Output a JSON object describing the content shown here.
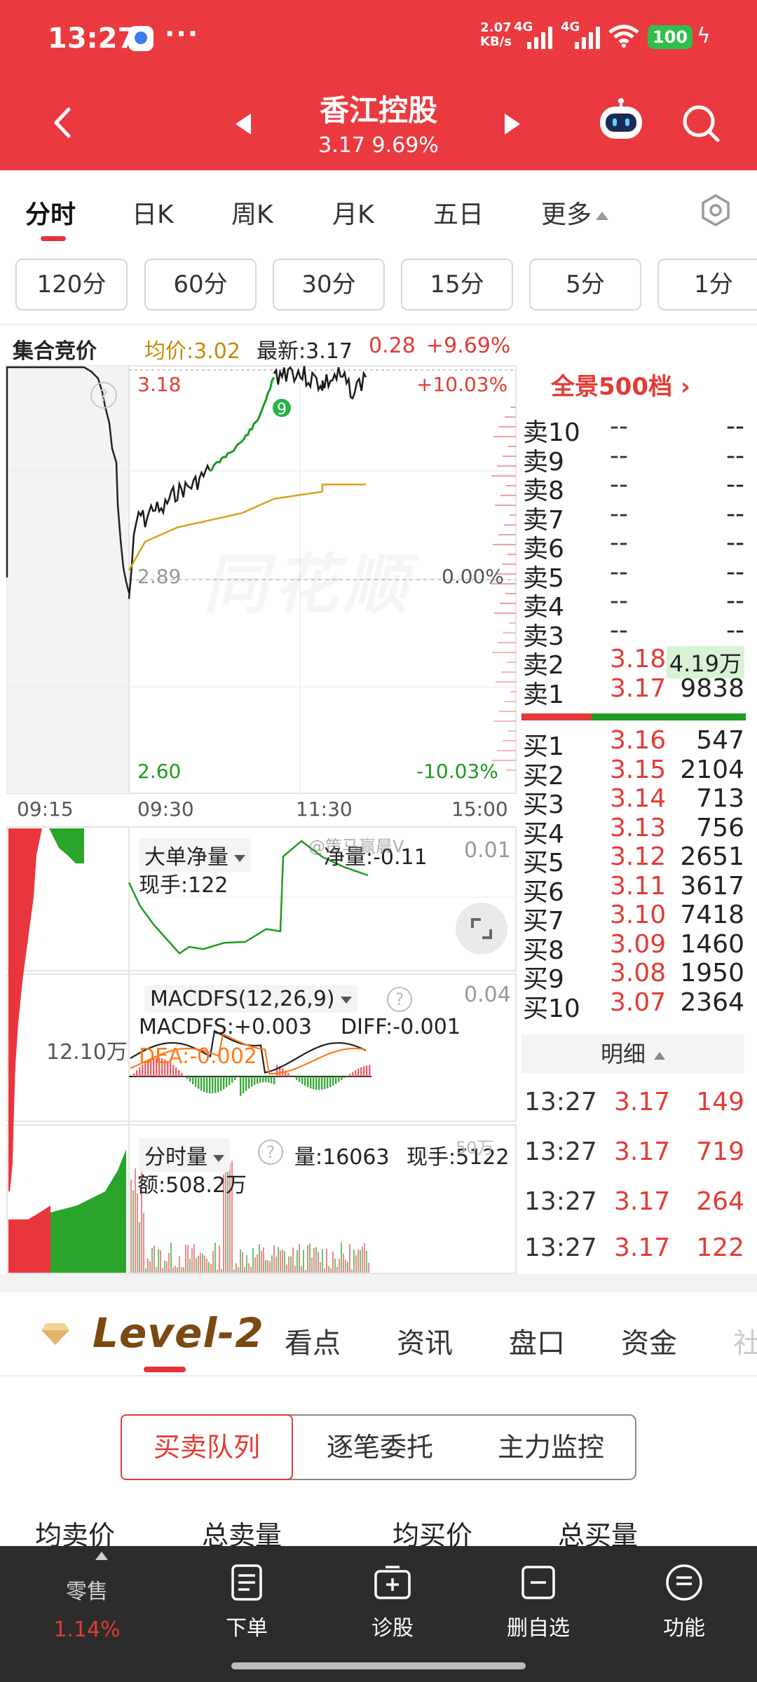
{
  "status": {
    "time": "13:27",
    "dots": "···",
    "speed_value": "2.07",
    "speed_unit": "KB/s",
    "sig1": "4G",
    "sig2": "4G",
    "battery": "100"
  },
  "header": {
    "title": "香江控股",
    "subtitle": "3.17 9.69%"
  },
  "tabs": [
    {
      "label": "分时"
    },
    {
      "label": "日K"
    },
    {
      "label": "周K"
    },
    {
      "label": "月K"
    },
    {
      "label": "五日"
    },
    {
      "label": "更多"
    }
  ],
  "minute_buttons": [
    "120分",
    "60分",
    "30分",
    "15分",
    "5分",
    "1分"
  ],
  "info": {
    "auction": "集合竞价",
    "avg": "均价:3.02",
    "latest": "最新:3.17",
    "change": "0.28",
    "pct": "+9.69%"
  },
  "chart": {
    "price_high": "3.18",
    "price_mid": "2.89",
    "price_low": "2.60",
    "pct_high": "+10.03%",
    "pct_mid": "0.00%",
    "pct_low": "-10.03%",
    "times": [
      "09:15",
      "09:30",
      "11:30",
      "15:00"
    ],
    "auction_volume": "12.10万",
    "marker": "9"
  },
  "chart_data": {
    "type": "line",
    "title": "",
    "x_range": [
      "09:30",
      "15:00"
    ],
    "ylim": [
      2.6,
      3.18
    ],
    "prev_close": 2.89,
    "series": [
      {
        "x": [
          "09:30",
          "09:33",
          "09:36",
          "09:40",
          "09:45",
          "09:50",
          "09:55",
          "10:00",
          "10:10",
          "10:20",
          "10:30",
          "10:40",
          "10:50",
          "11:00",
          "11:10",
          "11:20",
          "11:30",
          "13:00",
          "13:10",
          "13:20",
          "13:27"
        ],
        "values": [
          2.86,
          2.94,
          2.98,
          2.97,
          2.99,
          2.98,
          3.0,
          3.01,
          3.02,
          3.04,
          3.06,
          3.08,
          3.11,
          3.17,
          3.18,
          3.17,
          3.16,
          3.16,
          3.17,
          3.15,
          3.17
        ]
      },
      {
        "x": [
          "09:30",
          "09:40",
          "10:00",
          "10:20",
          "10:40",
          "11:00",
          "11:30",
          "13:00",
          "13:27"
        ],
        "values": [
          2.9,
          2.94,
          2.96,
          2.97,
          2.98,
          3.0,
          3.01,
          3.02,
          3.02
        ]
      }
    ]
  },
  "sub1": {
    "name": "大单净量",
    "hand": "现手:122",
    "net": "净量:-0.11",
    "scale": "0.01"
  },
  "sub2": {
    "name": "MACDFS(12,26,9)",
    "macd": "MACDFS:+0.003",
    "diff": "DIFF:-0.001",
    "dea": "DEA:-0.002",
    "scale": "0.04"
  },
  "sub3": {
    "name": "分时量",
    "vol": "量:16063",
    "hand": "现手:5122",
    "amount": "额:508.2万",
    "scale": "50万"
  },
  "book": {
    "title": "全景500档",
    "asks": [
      {
        "l": "卖10",
        "p": "--",
        "v": "--"
      },
      {
        "l": "卖9",
        "p": "--",
        "v": "--"
      },
      {
        "l": "卖8",
        "p": "--",
        "v": "--"
      },
      {
        "l": "卖7",
        "p": "--",
        "v": "--"
      },
      {
        "l": "卖6",
        "p": "--",
        "v": "--"
      },
      {
        "l": "卖5",
        "p": "--",
        "v": "--"
      },
      {
        "l": "卖4",
        "p": "--",
        "v": "--"
      },
      {
        "l": "卖3",
        "p": "--",
        "v": "--"
      },
      {
        "l": "卖2",
        "p": "3.18",
        "v": "4.19万"
      },
      {
        "l": "卖1",
        "p": "3.17",
        "v": "9838"
      }
    ],
    "bids": [
      {
        "l": "买1",
        "p": "3.16",
        "v": "547"
      },
      {
        "l": "买2",
        "p": "3.15",
        "v": "2104"
      },
      {
        "l": "买3",
        "p": "3.14",
        "v": "713"
      },
      {
        "l": "买4",
        "p": "3.13",
        "v": "756"
      },
      {
        "l": "买5",
        "p": "3.12",
        "v": "2651"
      },
      {
        "l": "买6",
        "p": "3.11",
        "v": "3617"
      },
      {
        "l": "买7",
        "p": "3.10",
        "v": "7418"
      },
      {
        "l": "买8",
        "p": "3.09",
        "v": "1460"
      },
      {
        "l": "买9",
        "p": "3.08",
        "v": "1950"
      },
      {
        "l": "买10",
        "p": "3.07",
        "v": "2364"
      }
    ],
    "detail": "明细",
    "trades": [
      {
        "t": "13:27",
        "p": "3.17",
        "v": "149"
      },
      {
        "t": "13:27",
        "p": "3.17",
        "v": "719"
      },
      {
        "t": "13:27",
        "p": "3.17",
        "v": "264"
      },
      {
        "t": "13:27",
        "p": "3.17",
        "v": "122"
      }
    ]
  },
  "level2": {
    "brand": "Level-2",
    "tabs": [
      "看点",
      "资讯",
      "盘口",
      "资金",
      "社"
    ],
    "segments": [
      "买卖队列",
      "逐笔委托",
      "主力监控"
    ],
    "columns": [
      "均卖价",
      "总卖量",
      "均买价",
      "总买量"
    ]
  },
  "nav": [
    {
      "label": "零售",
      "sub": "1.14%"
    },
    {
      "label": "下单"
    },
    {
      "label": "诊股"
    },
    {
      "label": "删自选"
    },
    {
      "label": "功能"
    }
  ],
  "watermark": "同花顺",
  "weibo": "@策马赢晨V"
}
